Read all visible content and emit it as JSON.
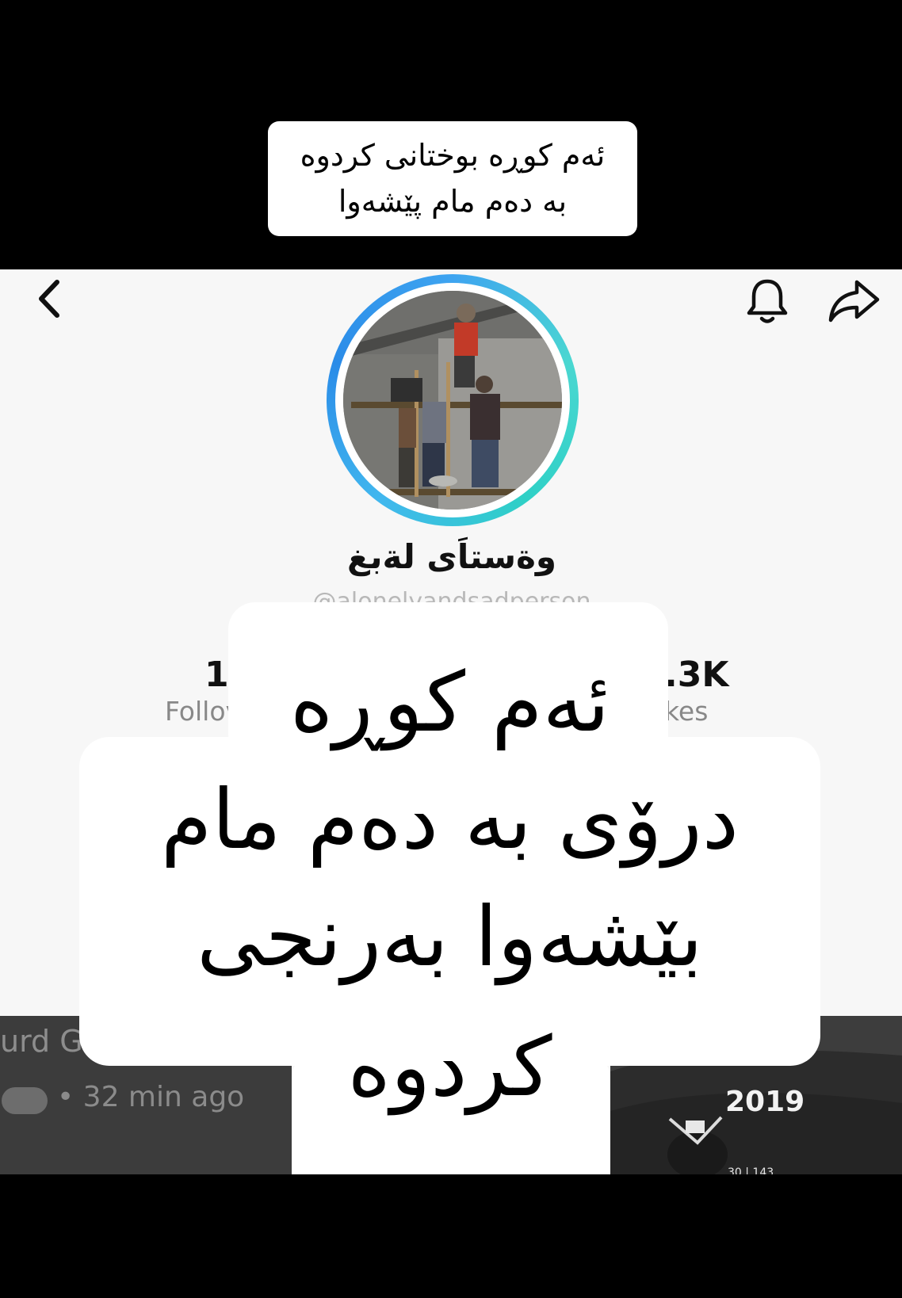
{
  "top_caption": {
    "line1": "ئەم کوڕە بوختانی کردوە",
    "line2": "بە دەم مام پێشەوا"
  },
  "profile": {
    "name": "وةستاَى لةبغ",
    "username": "@alonelyandsadperson",
    "stats": {
      "followers_fragment": "16",
      "followers_label_fragment": "Follov",
      "likes_fragment": ".3K",
      "likes_label_fragment": "kes"
    }
  },
  "overlay_caption": {
    "line1": "ئەم کوڕە",
    "line2": "درۆی بە دەم مام",
    "line3": "بێشەوا بەرنجی",
    "line4": "کردوە"
  },
  "background_video_left": {
    "channel_fragment": "urd G",
    "time": "• 32 min ago"
  },
  "background_video_right": {
    "year": "2019",
    "counter": "30 | 143"
  },
  "icons": {
    "back": "chevron-left-icon",
    "notifications": "bell-icon",
    "share": "share-arrow-icon"
  },
  "colors": {
    "ring_blue": "#3ea4f0",
    "ring_teal": "#2fd0c6",
    "profile_bg": "#f7f7f7",
    "caption_bg": "#ffffff",
    "band": "#000000"
  }
}
